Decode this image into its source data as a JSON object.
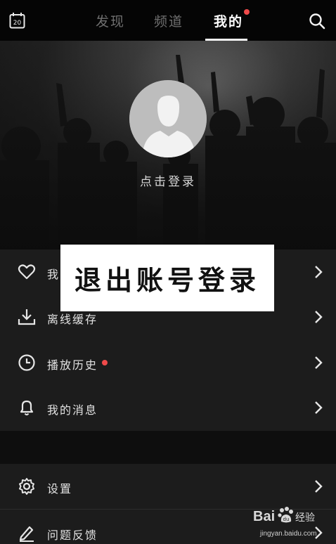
{
  "header": {
    "calendar_day": "20",
    "tabs": [
      {
        "label": "发现",
        "active": false
      },
      {
        "label": "频道",
        "active": false
      },
      {
        "label": "我的",
        "active": true,
        "badge": "red-dot"
      }
    ],
    "icons": {
      "left": "calendar-icon",
      "right": "search-icon"
    }
  },
  "profile": {
    "avatar": "default-avatar-silhouette",
    "login_prompt": "点击登录"
  },
  "menu_group_1": [
    {
      "label": "我",
      "icon": "heart-icon"
    },
    {
      "label": "离线缓存",
      "icon": "download-icon"
    },
    {
      "label": "播放历史",
      "icon": "clock-icon",
      "badge": "red-dot"
    },
    {
      "label": "我的消息",
      "icon": "bell-icon"
    }
  ],
  "menu_group_2": [
    {
      "label": "设置",
      "icon": "gear-icon"
    },
    {
      "label": "问题反馈",
      "icon": "edit-icon"
    }
  ],
  "overlay_caption": "退出账号登录",
  "watermark": {
    "brand": "Bai",
    "cn": "经验",
    "url": "jingyan.baidu.com"
  },
  "colors": {
    "background": "#0e0e0e",
    "menu_bg": "#1c1c1c",
    "accent_dot": "#ef4a4a",
    "avatar": "#bdbdbd"
  }
}
